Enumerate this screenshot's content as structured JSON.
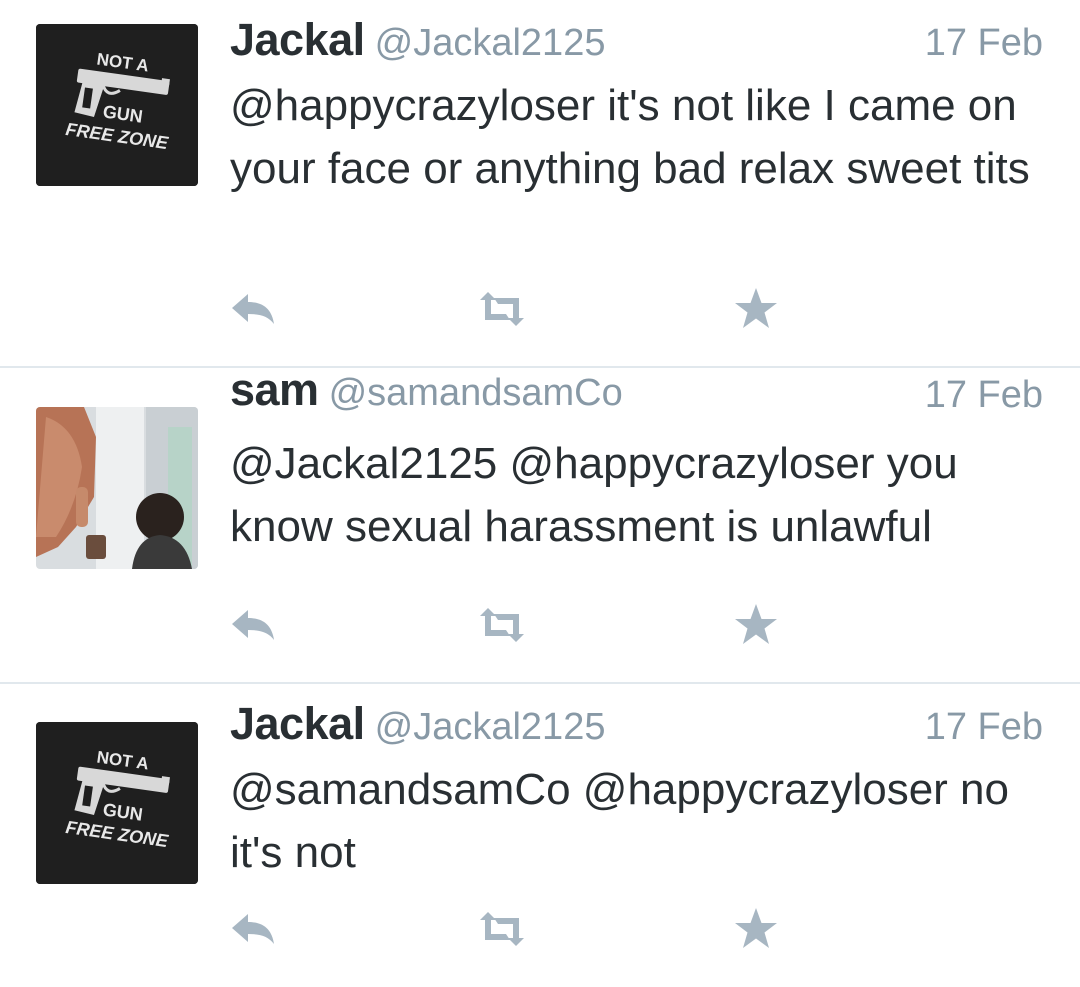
{
  "colors": {
    "name": "#292f33",
    "meta": "#8899a6",
    "icon": "#a7b6c2",
    "divider": "#e1e8ed"
  },
  "tweets": [
    {
      "name": "Jackal",
      "handle": "@Jackal2125",
      "date": "17 Feb",
      "text": "@happycrazyloser it's not like I came on your face or anything bad relax sweet tits",
      "avatar": {
        "type": "logo",
        "lines": [
          "NOT A",
          "GUN",
          "FREE ZONE"
        ]
      }
    },
    {
      "name": "sam",
      "handle": "@samandsamCo",
      "date": "17 Feb",
      "text": "@Jackal2125 @happycrazyloser you know sexual harassment is unlawful",
      "avatar": {
        "type": "photo"
      }
    },
    {
      "name": "Jackal",
      "handle": "@Jackal2125",
      "date": "17 Feb",
      "text": "@samandsamCo @happycrazyloser no it's not",
      "avatar": {
        "type": "logo",
        "lines": [
          "NOT A",
          "GUN",
          "FREE ZONE"
        ]
      }
    }
  ],
  "actions": [
    {
      "icon": "reply-icon"
    },
    {
      "icon": "retweet-icon"
    },
    {
      "icon": "favorite-star-icon"
    }
  ]
}
